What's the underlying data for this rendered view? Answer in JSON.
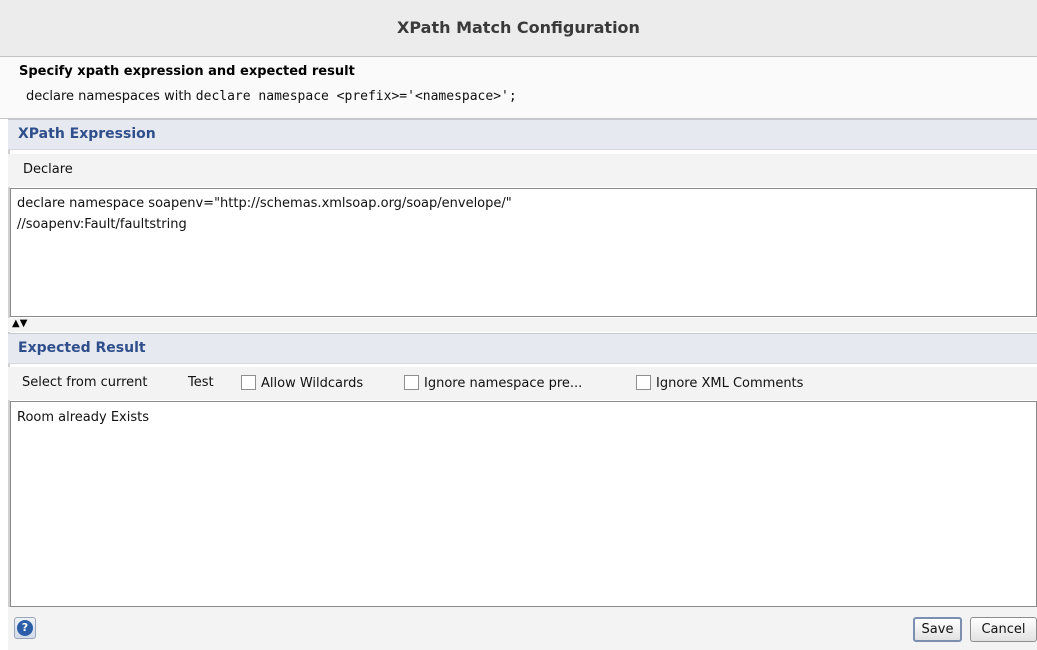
{
  "dialog": {
    "title": "XPath Match Configuration"
  },
  "description": {
    "heading": "Specify xpath expression and expected result",
    "sub_prefix": "declare namespaces with ",
    "sub_code": "declare namespace <prefix>='<namespace>';"
  },
  "xpath": {
    "header": "XPath Expression",
    "toolbar": {
      "declare_label": "Declare"
    },
    "lines": [
      "declare namespace soapenv=\"http://schemas.xmlsoap.org/soap/envelope/\"",
      "//soapenv:Fault/faultstring"
    ]
  },
  "splitter": {
    "arrows": "▲▼"
  },
  "expected": {
    "header": "Expected Result",
    "toolbar": {
      "select_label": "Select from current",
      "test_label": "Test",
      "allow_wildcards": {
        "label": "Allow Wildcards",
        "checked": false
      },
      "ignore_ns": {
        "label": "Ignore namespace pre...",
        "checked": false
      },
      "ignore_comments": {
        "label": "Ignore XML Comments",
        "checked": false
      }
    },
    "value": "Room already Exists"
  },
  "footer": {
    "help_icon": "help-icon",
    "help_glyph": "?",
    "save_label": "Save",
    "cancel_label": "Cancel"
  }
}
